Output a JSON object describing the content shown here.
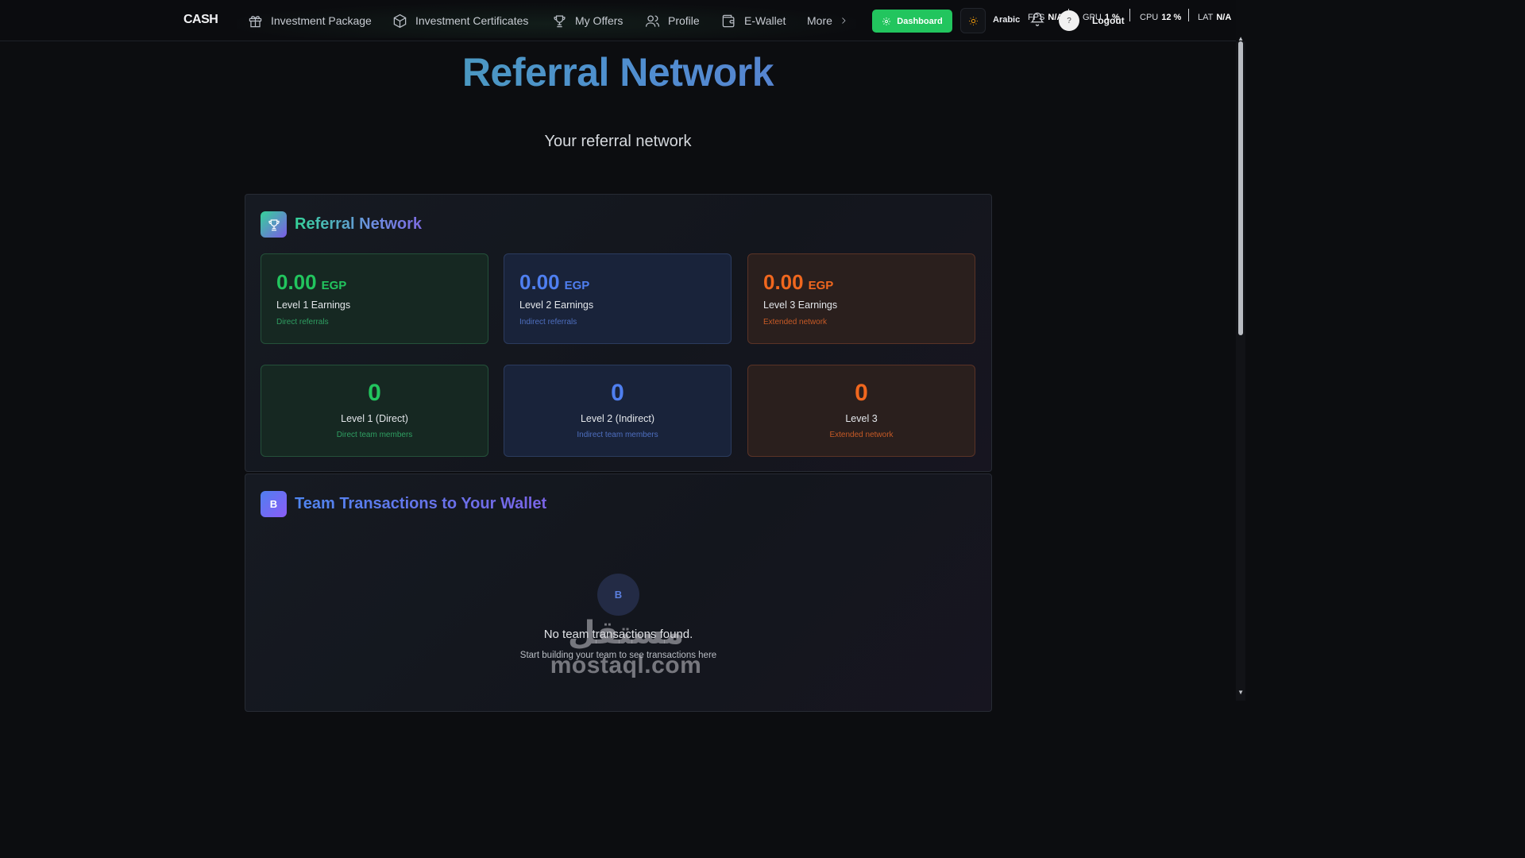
{
  "header": {
    "logo": "CASH",
    "nav": [
      {
        "label": "Investment Package",
        "icon": "gift-icon"
      },
      {
        "label": "Investment Certificates",
        "icon": "box-icon"
      },
      {
        "label": "My Offers",
        "icon": "trophy-icon"
      },
      {
        "label": "Profile",
        "icon": "users-icon"
      },
      {
        "label": "E-Wallet",
        "icon": "wallet-icon"
      },
      {
        "label": "More",
        "icon": "chevron-right-icon"
      }
    ],
    "dashboard_label": "Dashboard",
    "language_label": "Arabic",
    "logout_label": "Logout",
    "avatar_text": "?",
    "perf": {
      "fps_label": "FPS",
      "fps_value": "N/A",
      "gpu_label": "GPU",
      "gpu_value": "1 %",
      "cpu_label": "CPU",
      "cpu_value": "12 %",
      "lat_label": "LAT",
      "lat_value": "N/A"
    }
  },
  "page": {
    "title": "Referral Network",
    "subtitle": "Your referral network"
  },
  "referral_panel": {
    "title": "Referral Network",
    "earnings": [
      {
        "value": "0.00",
        "currency": "EGP",
        "label": "Level 1 Earnings",
        "sub": "Direct referrals"
      },
      {
        "value": "0.00",
        "currency": "EGP",
        "label": "Level 2 Earnings",
        "sub": "Indirect referrals"
      },
      {
        "value": "0.00",
        "currency": "EGP",
        "label": "Level 3 Earnings",
        "sub": "Extended network"
      }
    ],
    "counts": [
      {
        "value": "0",
        "label": "Level 1 (Direct)",
        "sub": "Direct team members"
      },
      {
        "value": "0",
        "label": "Level 2 (Indirect)",
        "sub": "Indirect team members"
      },
      {
        "value": "0",
        "label": "Level 3",
        "sub": "Extended network"
      }
    ]
  },
  "transactions_panel": {
    "title": "Team Transactions to Your Wallet",
    "icon_glyph": "B",
    "empty_title": "No team transactions found.",
    "empty_sub": "Start building your team to see transactions here"
  },
  "watermark": {
    "arabic": "مستقل",
    "latin": "mostaql.com"
  },
  "colors": {
    "accent_green": "#22c55e",
    "accent_blue": "#4f7ff0",
    "accent_orange": "#f0671e",
    "background": "#0c0d10"
  }
}
